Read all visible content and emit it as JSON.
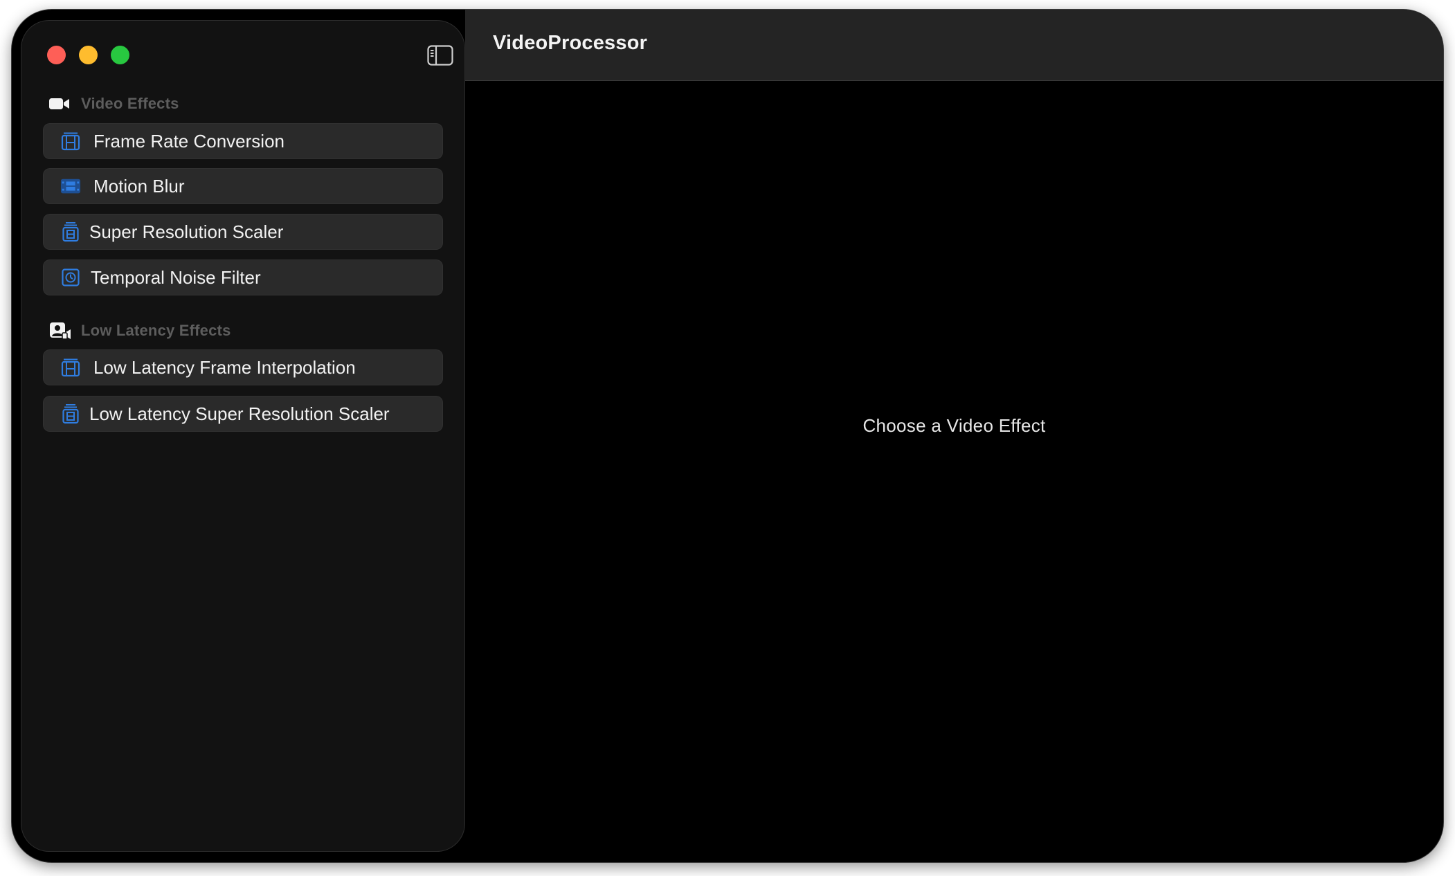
{
  "app": {
    "title": "VideoProcessor"
  },
  "sidebar": {
    "sections": [
      {
        "label": "Video Effects",
        "icon": "video-camera-icon",
        "items": [
          {
            "label": "Frame Rate Conversion",
            "icon": "film-frames-icon"
          },
          {
            "label": "Motion Blur",
            "icon": "film-strip-icon"
          },
          {
            "label": "Super Resolution Scaler",
            "icon": "film-stack-icon"
          },
          {
            "label": "Temporal Noise Filter",
            "icon": "timer-frame-icon"
          }
        ]
      },
      {
        "label": "Low Latency Effects",
        "icon": "person-video-icon",
        "items": [
          {
            "label": "Low Latency Frame Interpolation",
            "icon": "film-frames-icon"
          },
          {
            "label": "Low Latency Super Resolution Scaler",
            "icon": "film-stack-icon"
          }
        ]
      }
    ]
  },
  "main": {
    "empty_message": "Choose a Video Effect"
  },
  "colors": {
    "accent": "#2f7de1",
    "window_bg": "#000000",
    "sidebar_bg": "#121212",
    "item_bg": "#2a2a2a",
    "header_bg": "#242424"
  }
}
